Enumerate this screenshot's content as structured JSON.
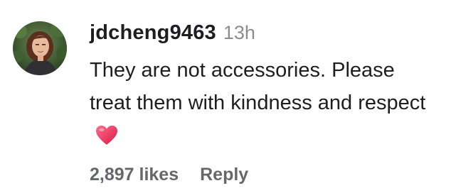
{
  "comment": {
    "username": "jdcheng9463",
    "timestamp": "13h",
    "text": "They are not accessories. Please treat them with kindness and respect",
    "emoji_icon": "red-heart-icon",
    "likes": "2,897 likes",
    "reply_label": "Reply"
  },
  "colors": {
    "text": "#1c1e21",
    "muted": "#8a8d91",
    "action": "#65676b",
    "heart": "#e8345a"
  }
}
